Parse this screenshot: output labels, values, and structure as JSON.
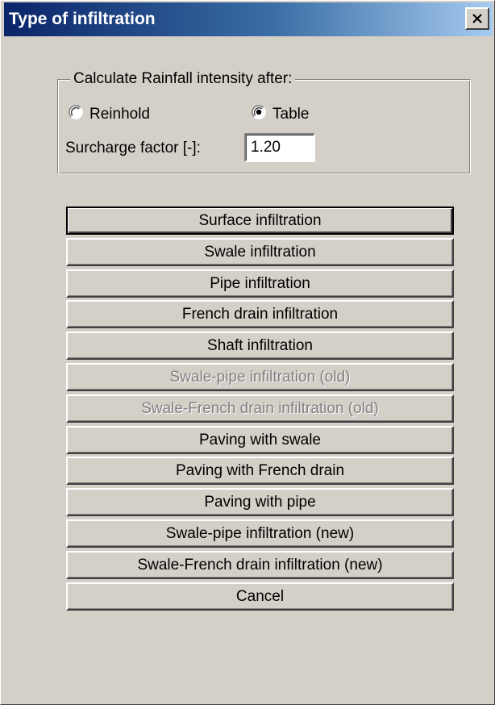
{
  "window": {
    "title": "Type of infiltration",
    "close_icon": "close-icon"
  },
  "rainfall_group": {
    "legend": "Calculate Rainfall intensity after:",
    "options": [
      {
        "label": "Reinhold",
        "selected": false
      },
      {
        "label": "Table",
        "selected": true
      }
    ],
    "surcharge_label": "Surcharge factor [-]:",
    "surcharge_value": "1.20"
  },
  "buttons": [
    {
      "label": "Surface infiltration",
      "enabled": true,
      "default": true
    },
    {
      "label": "Swale infiltration",
      "enabled": true
    },
    {
      "label": "Pipe infiltration",
      "enabled": true
    },
    {
      "label": "French drain infiltration",
      "enabled": true
    },
    {
      "label": "Shaft infiltration",
      "enabled": true
    },
    {
      "label": "Swale-pipe infiltration (old)",
      "enabled": false
    },
    {
      "label": "Swale-French drain infiltration (old)",
      "enabled": false
    },
    {
      "label": "Paving with swale",
      "enabled": true
    },
    {
      "label": "Paving with French drain",
      "enabled": true
    },
    {
      "label": "Paving with pipe",
      "enabled": true
    },
    {
      "label": "Swale-pipe infiltration (new)",
      "enabled": true
    },
    {
      "label": "Swale-French drain infiltration (new)",
      "enabled": true
    },
    {
      "label": "Cancel",
      "enabled": true
    }
  ],
  "colors": {
    "dialog_face": "#d4d0c8",
    "titlebar_start": "#0a246a",
    "titlebar_end": "#a6caf0",
    "disabled_text": "#808080"
  }
}
